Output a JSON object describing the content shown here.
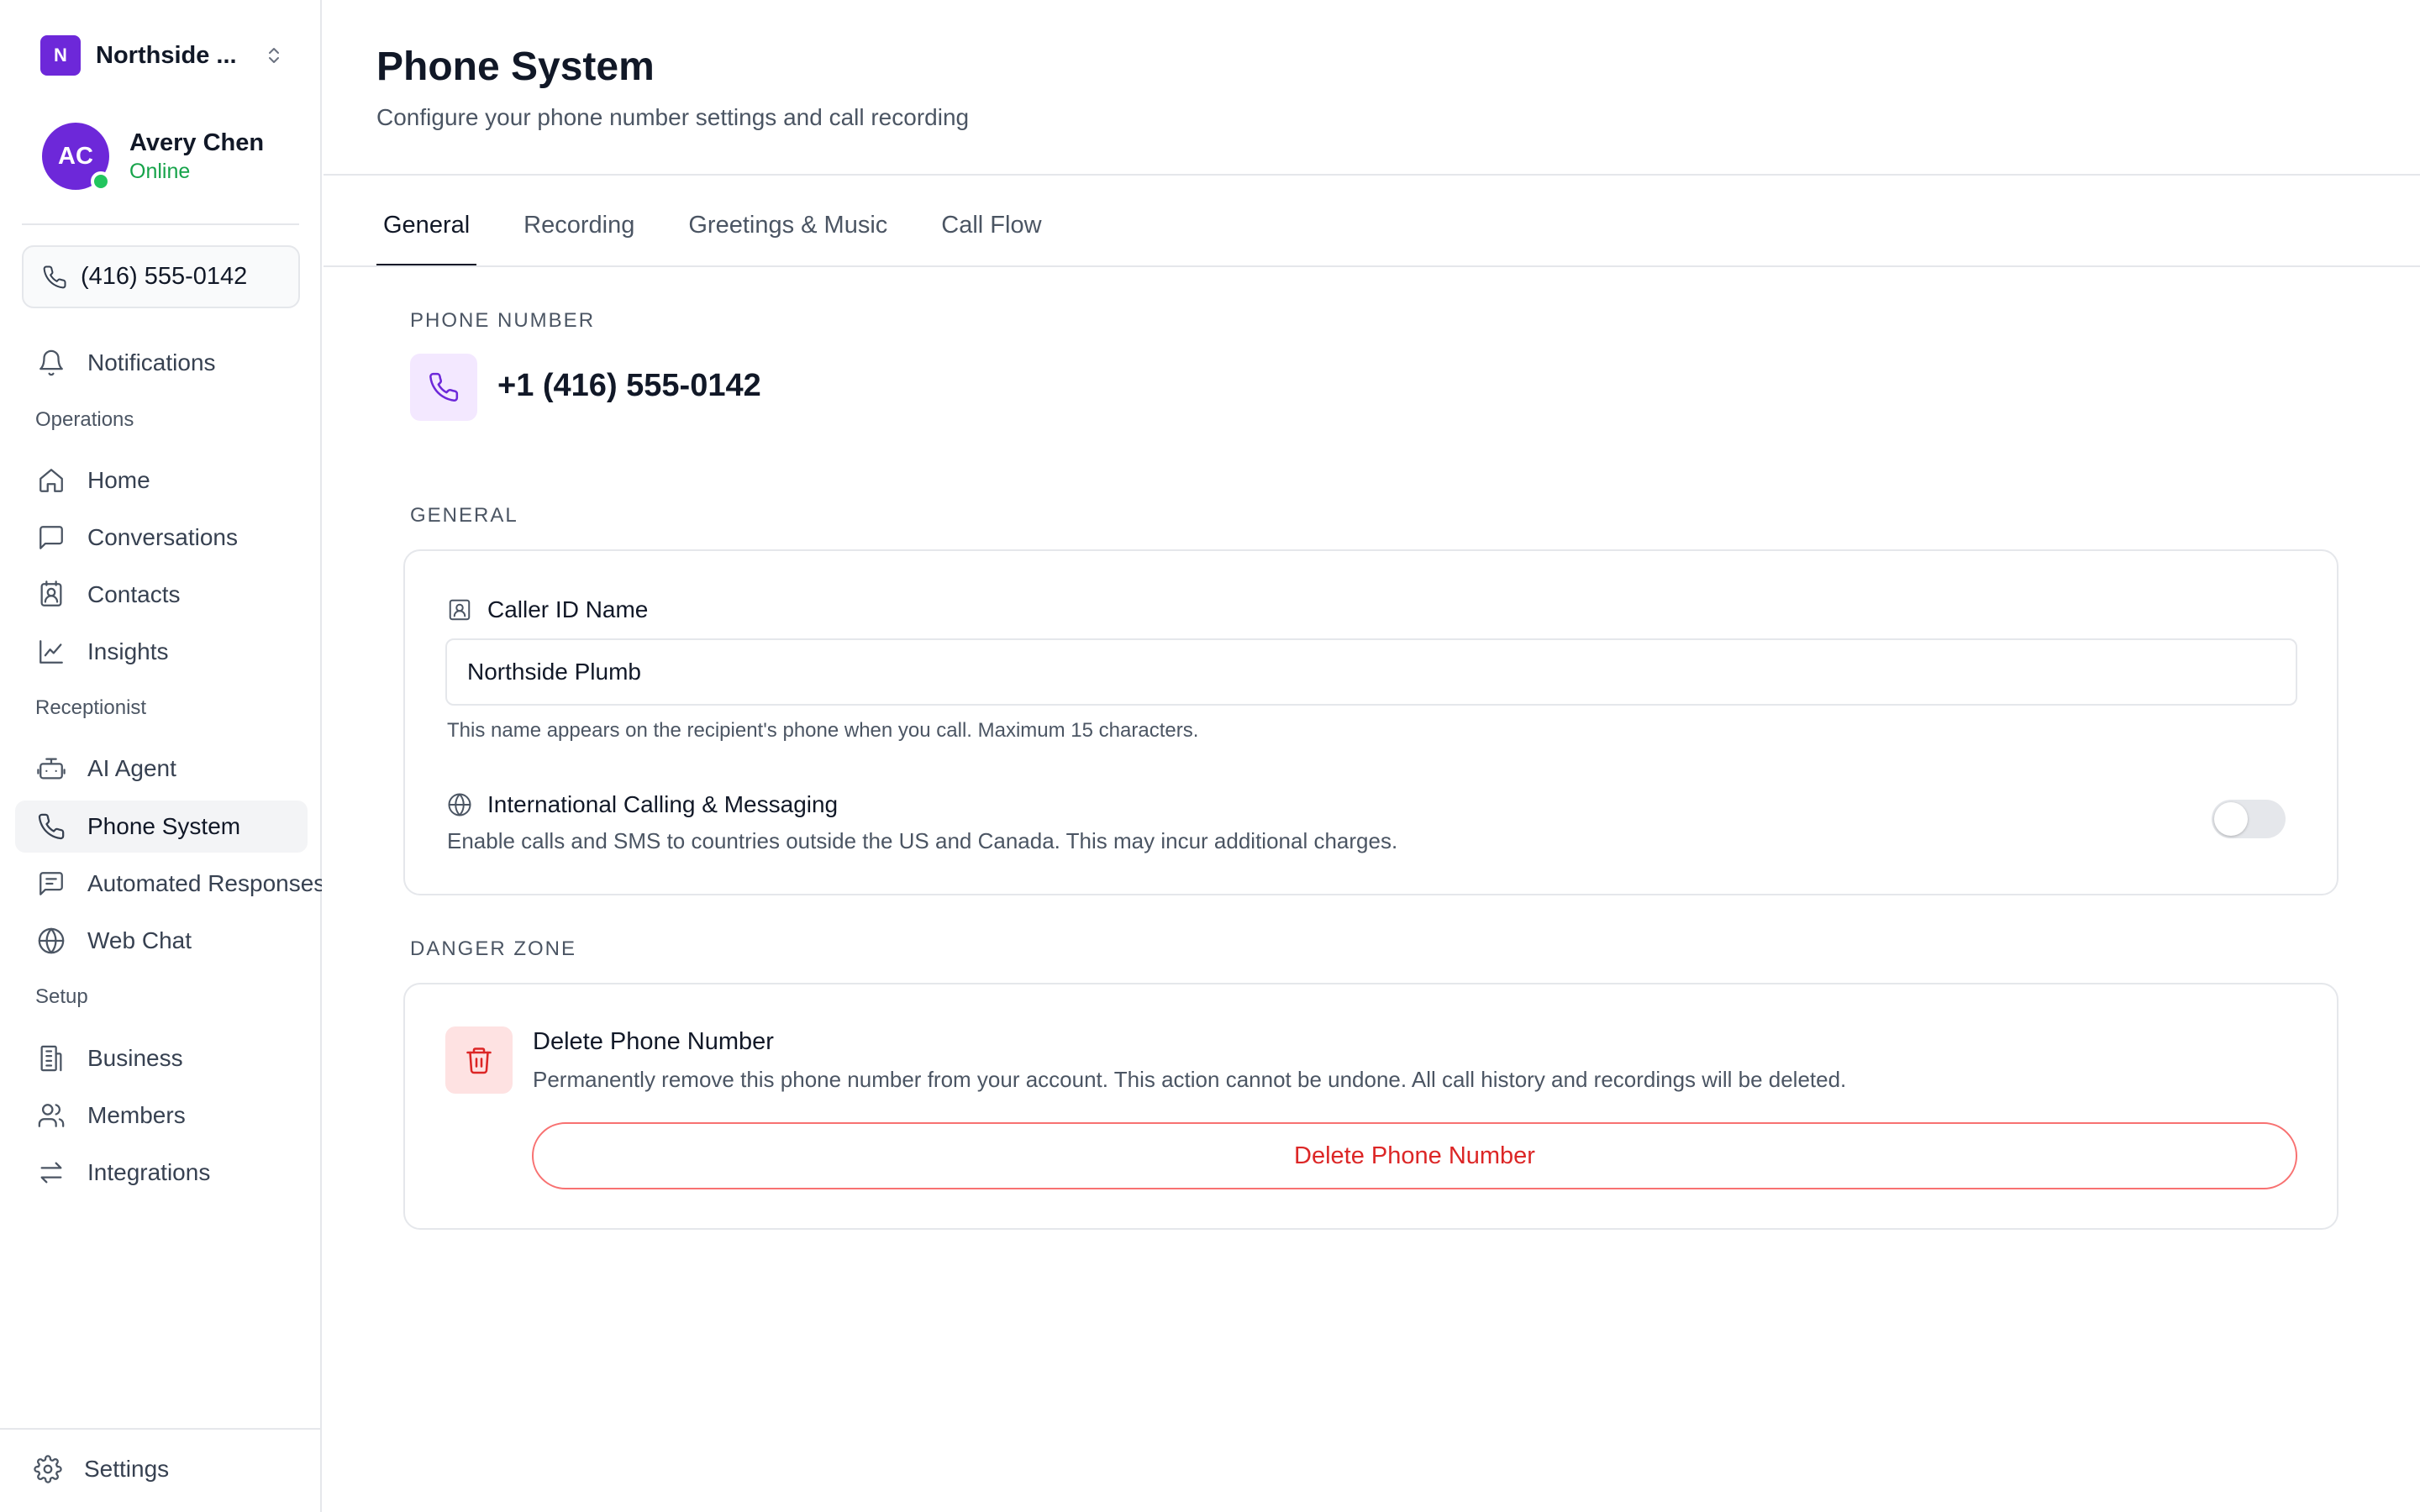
{
  "colors": {
    "brand": "#6d28d9",
    "online": "#16a34a",
    "danger": "#dc2626",
    "danger_bg": "#fee2e2",
    "accent_bg": "#f3e8ff"
  },
  "workspace": {
    "initial": "N",
    "name": "Northside ...",
    "switch_icon": "chevrons-up-down-icon"
  },
  "user": {
    "initials": "AC",
    "name": "Avery Chen",
    "status": "Online"
  },
  "phone_chip": {
    "number": "(416) 555-0142",
    "icon": "phone-icon"
  },
  "sidebar": {
    "notifications": {
      "label": "Notifications",
      "icon": "bell-icon"
    },
    "sections": [
      {
        "title": "Operations",
        "items": [
          {
            "label": "Home",
            "icon": "home-icon"
          },
          {
            "label": "Conversations",
            "icon": "message-square-icon"
          },
          {
            "label": "Contacts",
            "icon": "contact-icon"
          },
          {
            "label": "Insights",
            "icon": "line-chart-icon"
          }
        ]
      },
      {
        "title": "Receptionist",
        "items": [
          {
            "label": "AI Agent",
            "icon": "bot-icon"
          },
          {
            "label": "Phone System",
            "icon": "phone-icon",
            "active": true
          },
          {
            "label": "Automated Responses",
            "icon": "message-lines-icon"
          },
          {
            "label": "Web Chat",
            "icon": "globe-icon"
          }
        ]
      },
      {
        "title": "Setup",
        "items": [
          {
            "label": "Business",
            "icon": "building-icon"
          },
          {
            "label": "Members",
            "icon": "users-icon"
          },
          {
            "label": "Integrations",
            "icon": "arrows-swap-icon"
          }
        ]
      }
    ],
    "settings": {
      "label": "Settings",
      "icon": "gear-icon"
    }
  },
  "page": {
    "title": "Phone System",
    "subtitle": "Configure your phone number settings and call recording"
  },
  "tabs": [
    {
      "label": "General",
      "active": true
    },
    {
      "label": "Recording"
    },
    {
      "label": "Greetings & Music"
    },
    {
      "label": "Call Flow"
    }
  ],
  "phone_number_section": {
    "label": "PHONE NUMBER",
    "value": "+1 (416) 555-0142"
  },
  "general_section": {
    "label": "GENERAL",
    "caller_id": {
      "label": "Caller ID Name",
      "value": "Northside Plumb",
      "help": "This name appears on the recipient's phone when you call. Maximum 15 characters."
    },
    "international": {
      "title": "International Calling & Messaging",
      "description": "Enable calls and SMS to countries outside the US and Canada. This may incur additional charges.",
      "enabled": false
    }
  },
  "danger_section": {
    "label": "DANGER ZONE",
    "title": "Delete Phone Number",
    "description": "Permanently remove this phone number from your account. This action cannot be undone. All call history and recordings will be deleted.",
    "button_label": "Delete Phone Number"
  }
}
